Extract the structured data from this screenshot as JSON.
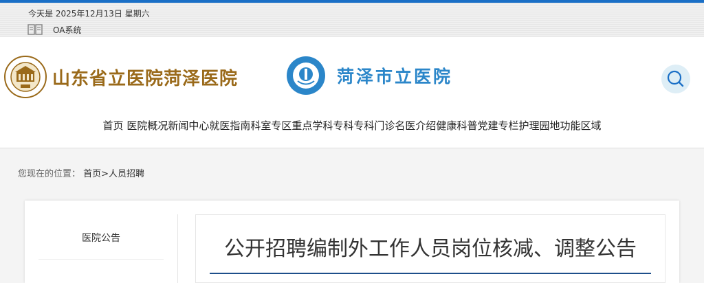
{
  "top": {
    "date_label": "今天是 2025年12月13日 星期六",
    "oa_link": "OA系统"
  },
  "header": {
    "hospital_name": "山东省立医院菏泽医院",
    "city_hospital_name": "菏泽市立医院"
  },
  "nav": {
    "items": [
      "首页",
      "医院概况",
      "新闻中心",
      "就医指南",
      "科室专区",
      "重点学科",
      "专科专科门诊",
      "名医介绍",
      "健康科普",
      "党建专栏",
      "护理园地",
      "功能区域"
    ]
  },
  "breadcrumb": {
    "prefix": "您现在的位置：",
    "path": "首页>人员招聘"
  },
  "sidebar": {
    "items": [
      {
        "label": "医院公告"
      }
    ]
  },
  "article": {
    "title": "公开招聘编制外工作人员岗位核减、调整公告"
  },
  "colors": {
    "brand_blue": "#1a6fc6",
    "logo_gold": "#9a6a1a",
    "logo_blue": "#2b86c9"
  }
}
